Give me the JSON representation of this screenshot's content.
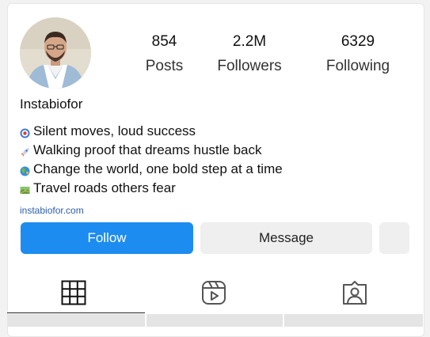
{
  "profile": {
    "username": "Instabiofor",
    "stats": [
      {
        "value": "854",
        "label": "Posts"
      },
      {
        "value": "2.2M",
        "label": "Followers"
      },
      {
        "value": "6329",
        "label": "Following"
      }
    ],
    "bio": [
      {
        "icon": "target-icon",
        "text": "Silent moves, loud success"
      },
      {
        "icon": "rocket-icon",
        "text": "Walking proof that dreams hustle back"
      },
      {
        "icon": "globe-icon",
        "text": "Change the world, one bold step at a time"
      },
      {
        "icon": "map-icon",
        "text": "Travel roads others fear"
      }
    ],
    "link": "instabiofor.com"
  },
  "actions": {
    "follow_label": "Follow",
    "message_label": "Message"
  },
  "colors": {
    "follow_button": "#1c8cf0",
    "secondary_button": "#efefef",
    "link": "#2c5fa8"
  }
}
